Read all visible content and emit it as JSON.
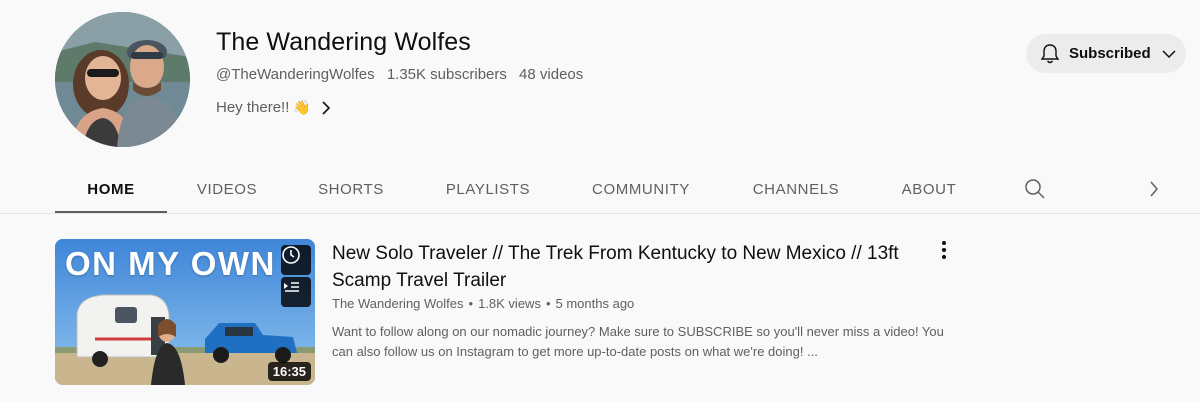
{
  "channel": {
    "name": "The Wandering Wolfes",
    "handle": "@TheWanderingWolfes",
    "subscribers": "1.35K subscribers",
    "videos": "48 videos",
    "description": "Hey there!!",
    "description_emoji": "👋"
  },
  "subscribe_button": {
    "label": "Subscribed"
  },
  "tabs": [
    {
      "label": "HOME",
      "active": true
    },
    {
      "label": "VIDEOS"
    },
    {
      "label": "SHORTS"
    },
    {
      "label": "PLAYLISTS"
    },
    {
      "label": "COMMUNITY"
    },
    {
      "label": "CHANNELS"
    },
    {
      "label": "ABOUT"
    }
  ],
  "featured_video": {
    "thumbnail_text": "ON MY OWN",
    "duration": "16:35",
    "title": "New Solo Traveler // The Trek From Kentucky to New Mexico // 13ft Scamp Travel Trailer",
    "channel": "The Wandering Wolfes",
    "views": "1.8K views",
    "age": "5 months ago",
    "description": "Want to follow along on our nomadic journey? Make sure to SUBSCRIBE so you'll never miss a video! You can also follow us on Instagram to get more up-to-date posts on what we're doing! ..."
  },
  "icons": {
    "bell": "bell-icon",
    "dropdown": "chevron-down-icon",
    "description_more": "chevron-right-icon",
    "search": "search-icon",
    "tabs_next": "chevron-right-icon",
    "watch_later": "clock-icon",
    "add_to_queue": "queue-icon",
    "video_menu": "more-vert-icon"
  },
  "colors": {
    "page_bg": "#f9f9f9",
    "text_primary": "#0f0f0f",
    "text_secondary": "#606060",
    "subscribed_bg": "#ececec"
  }
}
